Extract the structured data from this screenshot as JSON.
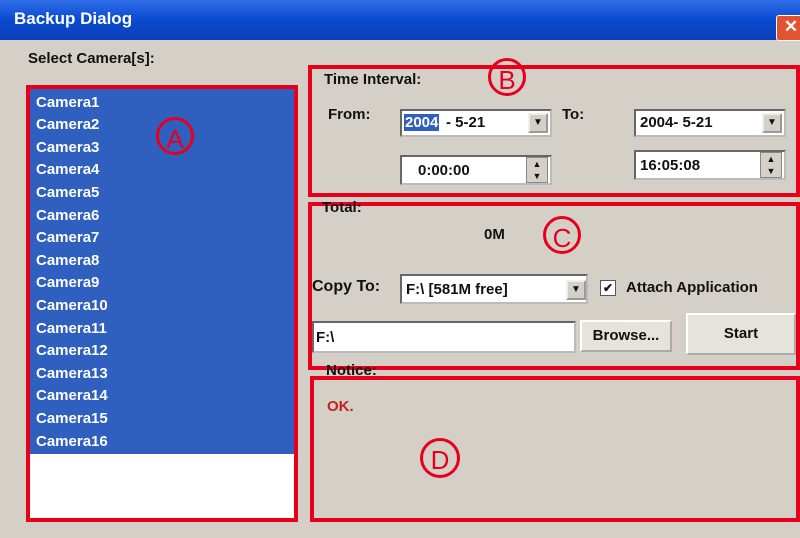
{
  "window": {
    "title": "Backup Dialog",
    "close": "✕"
  },
  "camera_section": {
    "label": "Select Camera[s]:",
    "cameras": [
      "Camera1",
      "Camera2",
      "Camera3",
      "Camera4",
      "Camera5",
      "Camera6",
      "Camera7",
      "Camera8",
      "Camera9",
      "Camera10",
      "Camera11",
      "Camera12",
      "Camera13",
      "Camera14",
      "Camera15",
      "Camera16"
    ]
  },
  "time_interval": {
    "label": "Time Interval:",
    "from_label": "From:",
    "from_date_year_selected": "2004",
    "from_date_rest": "- 5-21",
    "from_time": "0:00:00",
    "to_label": "To:",
    "to_date": "2004- 5-21",
    "to_time": "16:05:08"
  },
  "copy_section": {
    "total_label": "Total:",
    "total_value": "0M",
    "copy_to_label": "Copy To:",
    "drive_selected": "F:\\ [581M free]",
    "attach_label": "Attach Application",
    "attach_checked": true,
    "path_value": "F:\\",
    "browse_label": "Browse...",
    "start_label": "Start"
  },
  "notice": {
    "label": "Notice:",
    "message": "OK."
  },
  "annotations": {
    "a": "A",
    "b": "B",
    "c": "C",
    "d": "D"
  },
  "colors": {
    "highlight": "#e8001a",
    "selection": "#2f5fbf",
    "titlebar": "#0a4ad1"
  }
}
